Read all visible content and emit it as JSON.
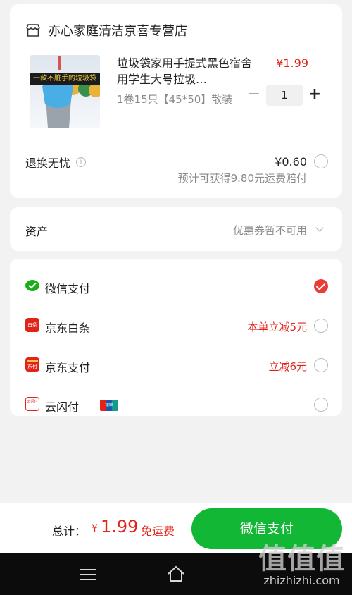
{
  "shop": {
    "name": "亦心家庭清洁京喜专营店"
  },
  "product": {
    "banner_text": "一款不脏手的垃圾袋",
    "title": "垃圾袋家用手提式黑色宿舍用学生大号拉圾…",
    "spec": "1卷15只【45*50】散装",
    "price": "¥1.99",
    "quantity": "1",
    "minus_symbol": "−",
    "plus_symbol": "+"
  },
  "return_service": {
    "label": "退换无忧",
    "info_symbol": "i",
    "price": "¥0.60",
    "note": "预计可获得9.80元运费赔付",
    "selected": false
  },
  "assets": {
    "label": "资产",
    "value": "优惠券暂不可用"
  },
  "payment_methods": [
    {
      "name": "微信支付",
      "promo": "",
      "selected": true,
      "icon": "wechat-pay-icon",
      "color": "#1aad19"
    },
    {
      "name": "京东白条",
      "promo": "本单立减5元",
      "selected": false,
      "icon": "jd-baitiao-icon",
      "color": "#e2231a",
      "icon_text": "白条"
    },
    {
      "name": "京东支付",
      "promo": "立减6元",
      "selected": false,
      "icon": "jd-pay-icon",
      "color": "#e2231a",
      "icon_text": "东付"
    },
    {
      "name": "云闪付",
      "promo": "",
      "selected": false,
      "icon": "quickpass-icon",
      "color": "#e2231a",
      "icon_text": "云闪付",
      "badge_text": "银联"
    }
  ],
  "footer": {
    "total_label": "总计：",
    "currency": "¥",
    "total_amount": "1.99",
    "shipping": "免运费",
    "pay_button": "微信支付"
  },
  "watermark": {
    "logo": "值值值",
    "url": "zhizhizhi.com"
  },
  "colors": {
    "accent_red": "#e2231a",
    "pay_green": "#13b736"
  }
}
